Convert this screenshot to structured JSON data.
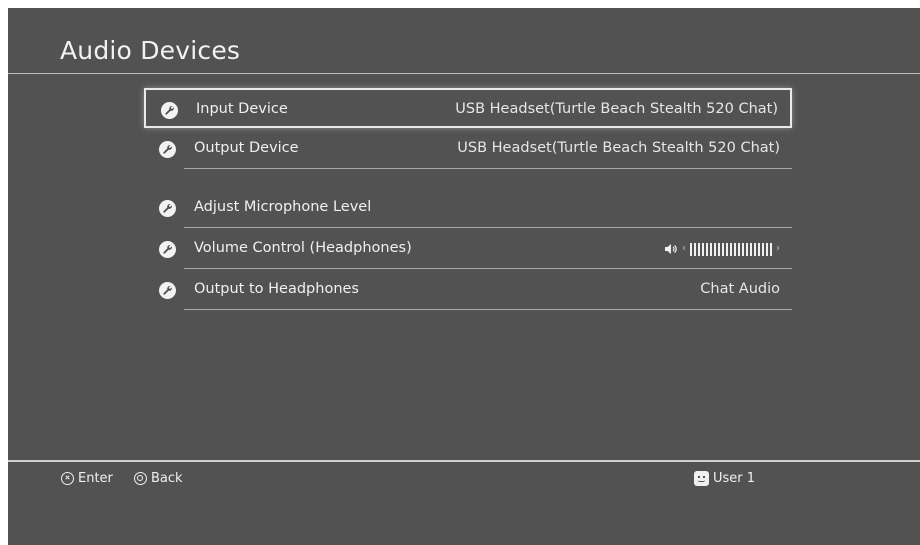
{
  "page": {
    "title": "Audio Devices"
  },
  "settings": [
    {
      "label": "Input Device",
      "value": "USB Headset(Turtle Beach Stealth 520 Chat)",
      "selected": true,
      "icon": "wrench-icon"
    },
    {
      "label": "Output Device",
      "value": "USB Headset(Turtle Beach Stealth 520 Chat)",
      "selected": false,
      "icon": "wrench-icon"
    },
    {
      "label": "Adjust Microphone Level",
      "value": "",
      "selected": false,
      "icon": "wrench-icon"
    },
    {
      "label": "Volume Control (Headphones)",
      "value": "",
      "selected": false,
      "icon": "wrench-icon",
      "volume_bars": 21
    },
    {
      "label": "Output to Headphones",
      "value": "Chat Audio",
      "selected": false,
      "icon": "wrench-icon"
    }
  ],
  "footer": {
    "enter_label": "Enter",
    "back_label": "Back",
    "user_label": "User 1"
  },
  "colors": {
    "background": "#525252",
    "text": "#f0f0f0",
    "divider": "#a8a8a8"
  }
}
